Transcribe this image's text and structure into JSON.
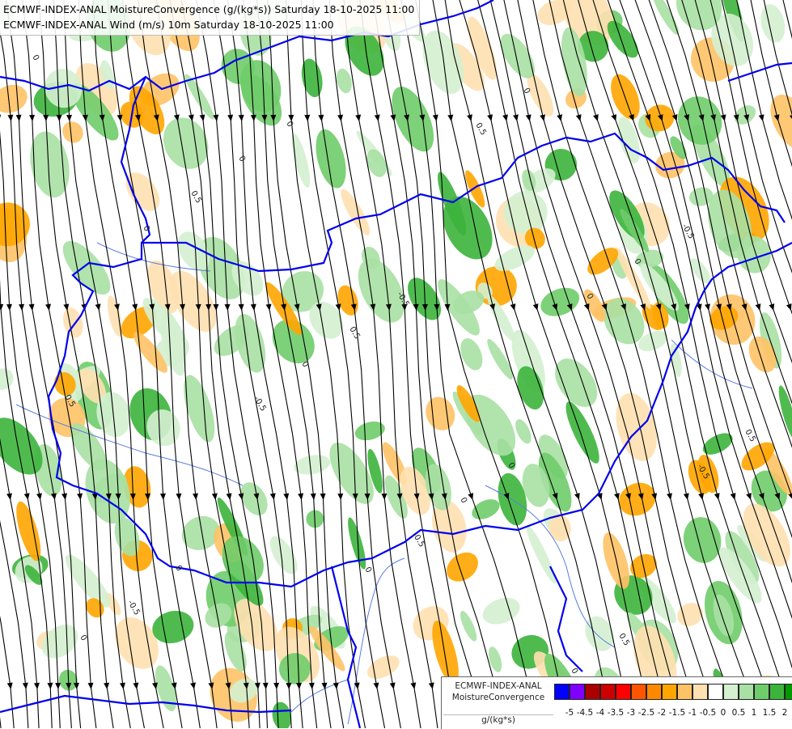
{
  "titles": {
    "line1": "ECMWF-INDEX-ANAL MoistureConvergence (g/(kg*s)) Saturday 18-10-2025 11:00",
    "line2": "ECMWF-INDEX-ANAL Wind (m/s) 10m Saturday 18-10-2025 11:00"
  },
  "legend": {
    "name_line1": "ECMWF-INDEX-ANAL",
    "name_line2": "MoistureConvergence",
    "unit": "g/(kg*s)",
    "swatches": [
      "#0000ff",
      "#8000ff",
      "#aa0000",
      "#cc0000",
      "#ff0000",
      "#ff5500",
      "#ff8800",
      "#ffa500",
      "#ffc266",
      "#ffe0b0",
      "#ffffff",
      "#d4f0d0",
      "#a9e0a3",
      "#6fcc6a",
      "#3cb43c",
      "#009900"
    ],
    "ticks": [
      "-5",
      "-4.5",
      "-4",
      "-3.5",
      "-3",
      "-2.5",
      "-2",
      "-1.5",
      "-1",
      "-0.5",
      "0",
      "0.5",
      "1",
      "1.5",
      "2"
    ]
  },
  "map": {
    "contour_labels": [
      "0",
      "0",
      "-0.5",
      "0",
      "0.5",
      "0",
      "-0.5",
      "0",
      "0.5",
      "0",
      "-0.5",
      "0",
      "0",
      "0.5",
      "-0.5",
      "0",
      "0.5",
      "0",
      "0",
      "-0.5",
      "0.5",
      "0",
      "0",
      "-0.5",
      "0",
      "0.5"
    ],
    "colors": {
      "border": "#0000ee",
      "river": "#5a7de0",
      "streamline": "#000000",
      "green_light": "#d4f0d0",
      "green_mid": "#a9e0a3",
      "green_strong": "#6fcc6a",
      "green_dark": "#3cb43c",
      "orange_light": "#ffe0b0",
      "orange_mid": "#ffc266",
      "orange_strong": "#ffa500"
    }
  }
}
